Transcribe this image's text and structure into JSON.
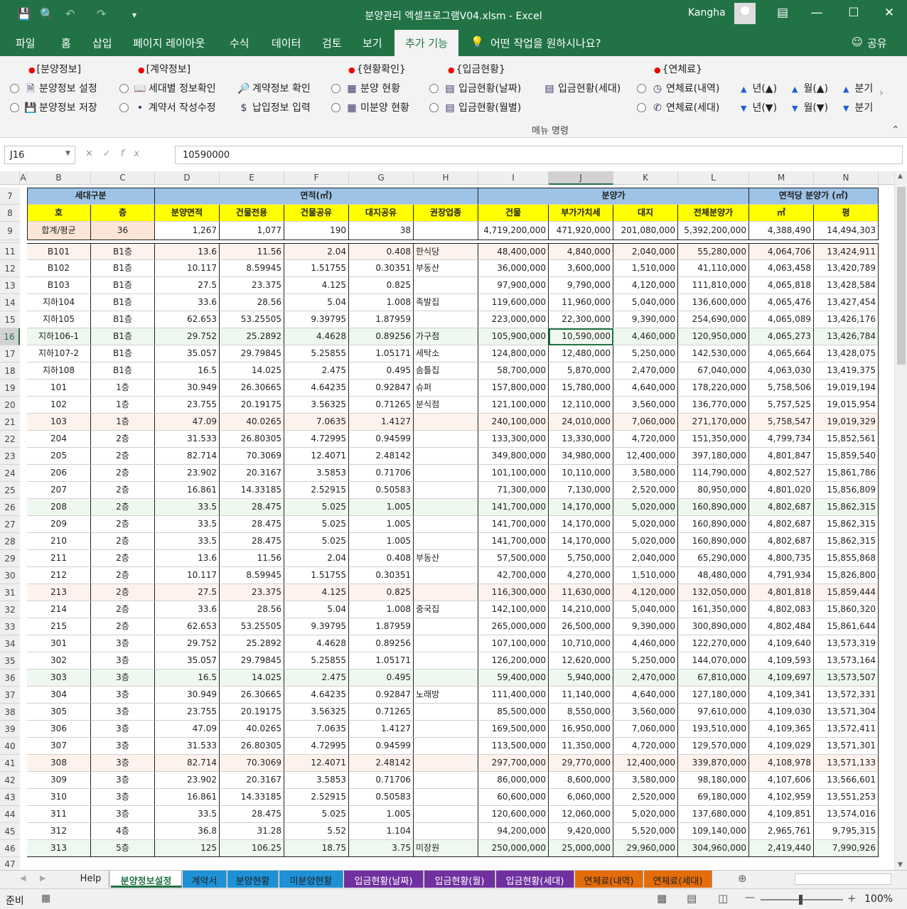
{
  "window": {
    "title": "분양관리 엑셀프로그램V04.xlsm  -  Excel",
    "user": "Kangha"
  },
  "ribbon_tabs": [
    "파일",
    "홈",
    "삽입",
    "페이지 레이아웃",
    "수식",
    "데이터",
    "검토",
    "보기",
    "추가 기능"
  ],
  "tell_me": "어떤 작업을 원하시나요?",
  "share": "공유",
  "ribbon": {
    "groups": [
      {
        "header": "[분양정보]",
        "items": [
          "분양정보 설정",
          "분양정보 저장"
        ]
      },
      {
        "header": "[계약정보]",
        "items": [
          "세대별 정보확인",
          "계약서 작성수정"
        ]
      },
      {
        "extra": [
          "계약정보 확인",
          "납입정보 입력"
        ]
      },
      {
        "header": "{현황확인}",
        "items": [
          "분양 현황",
          "미분양 현황"
        ]
      },
      {
        "header": "{입금현황}",
        "items": [
          "입금현황(날짜)",
          "입금현황(월별)"
        ]
      },
      {
        "extra": [
          "입금현황(세대)"
        ]
      },
      {
        "header": "{연체료}",
        "items": [
          "연체료(내역)",
          "연체료(세대)"
        ]
      }
    ],
    "spin": {
      "up": [
        "년(▲)",
        "월(▲)",
        "분기"
      ],
      "down": [
        "년(▼)",
        "월(▼)",
        "분기"
      ]
    },
    "footer": "메뉴 명령"
  },
  "formula_bar": {
    "name_box": "J16",
    "value": "10590000"
  },
  "columns": [
    "A",
    "B",
    "C",
    "D",
    "E",
    "F",
    "G",
    "H",
    "I",
    "J",
    "K",
    "L",
    "M",
    "N"
  ],
  "header": {
    "group1": [
      "세대구분",
      "면적(㎡)",
      "분양가",
      "면적당 분양가 (㎡)"
    ],
    "group2": [
      "호",
      "층",
      "분양면적",
      "건물전용",
      "건물공유",
      "대지공유",
      "권장업종",
      "건물",
      "부가가치세",
      "대지",
      "전체분양가",
      "㎡",
      "평"
    ],
    "totals": [
      "합계/평균",
      "36",
      "1,267",
      "1,077",
      "190",
      "38",
      "",
      "4,719,200,000",
      "471,920,000",
      "201,080,000",
      "5,392,200,000",
      "4,388,490",
      "14,494,303"
    ]
  },
  "rows": [
    [
      "11",
      "B101",
      "B1층",
      "13.6",
      "11.56",
      "2.04",
      "0.408",
      "한식당",
      "48,400,000",
      "4,840,000",
      "2,040,000",
      "55,280,000",
      "4,064,706",
      "13,424,911"
    ],
    [
      "12",
      "B102",
      "B1층",
      "10.117",
      "8.59945",
      "1.51755",
      "0.30351",
      "부동산",
      "36,000,000",
      "3,600,000",
      "1,510,000",
      "41,110,000",
      "4,063,458",
      "13,420,789"
    ],
    [
      "13",
      "B103",
      "B1층",
      "27.5",
      "23.375",
      "4.125",
      "0.825",
      "",
      "97,900,000",
      "9,790,000",
      "4,120,000",
      "111,810,000",
      "4,065,818",
      "13,428,584"
    ],
    [
      "14",
      "지하104",
      "B1층",
      "33.6",
      "28.56",
      "5.04",
      "1.008",
      "족발집",
      "119,600,000",
      "11,960,000",
      "5,040,000",
      "136,600,000",
      "4,065,476",
      "13,427,454"
    ],
    [
      "15",
      "지하105",
      "B1층",
      "62.653",
      "53.25505",
      "9.39795",
      "1.87959",
      "",
      "223,000,000",
      "22,300,000",
      "9,390,000",
      "254,690,000",
      "4,065,089",
      "13,426,176"
    ],
    [
      "16",
      "지하106-1",
      "B1층",
      "29.752",
      "25.2892",
      "4.4628",
      "0.89256",
      "가구점",
      "105,900,000",
      "10,590,000",
      "4,460,000",
      "120,950,000",
      "4,065,273",
      "13,426,784"
    ],
    [
      "17",
      "지하107-2",
      "B1층",
      "35.057",
      "29.79845",
      "5.25855",
      "1.05171",
      "세탁소",
      "124,800,000",
      "12,480,000",
      "5,250,000",
      "142,530,000",
      "4,065,664",
      "13,428,075"
    ],
    [
      "18",
      "지하108",
      "B1층",
      "16.5",
      "14.025",
      "2.475",
      "0.495",
      "솜틀집",
      "58,700,000",
      "5,870,000",
      "2,470,000",
      "67,040,000",
      "4,063,030",
      "13,419,375"
    ],
    [
      "19",
      "101",
      "1층",
      "30.949",
      "26.30665",
      "4.64235",
      "0.92847",
      "슈퍼",
      "157,800,000",
      "15,780,000",
      "4,640,000",
      "178,220,000",
      "5,758,506",
      "19,019,194"
    ],
    [
      "20",
      "102",
      "1층",
      "23.755",
      "20.19175",
      "3.56325",
      "0.71265",
      "분식점",
      "121,100,000",
      "12,110,000",
      "3,560,000",
      "136,770,000",
      "5,757,525",
      "19,015,954"
    ],
    [
      "21",
      "103",
      "1층",
      "47.09",
      "40.0265",
      "7.0635",
      "1.4127",
      "",
      "240,100,000",
      "24,010,000",
      "7,060,000",
      "271,170,000",
      "5,758,547",
      "19,019,329"
    ],
    [
      "22",
      "204",
      "2층",
      "31.533",
      "26.80305",
      "4.72995",
      "0.94599",
      "",
      "133,300,000",
      "13,330,000",
      "4,720,000",
      "151,350,000",
      "4,799,734",
      "15,852,561"
    ],
    [
      "23",
      "205",
      "2층",
      "82.714",
      "70.3069",
      "12.4071",
      "2.48142",
      "",
      "349,800,000",
      "34,980,000",
      "12,400,000",
      "397,180,000",
      "4,801,847",
      "15,859,540"
    ],
    [
      "24",
      "206",
      "2층",
      "23.902",
      "20.3167",
      "3.5853",
      "0.71706",
      "",
      "101,100,000",
      "10,110,000",
      "3,580,000",
      "114,790,000",
      "4,802,527",
      "15,861,786"
    ],
    [
      "25",
      "207",
      "2층",
      "16.861",
      "14.33185",
      "2.52915",
      "0.50583",
      "",
      "71,300,000",
      "7,130,000",
      "2,520,000",
      "80,950,000",
      "4,801,020",
      "15,856,809"
    ],
    [
      "26",
      "208",
      "2층",
      "33.5",
      "28.475",
      "5.025",
      "1.005",
      "",
      "141,700,000",
      "14,170,000",
      "5,020,000",
      "160,890,000",
      "4,802,687",
      "15,862,315"
    ],
    [
      "27",
      "209",
      "2층",
      "33.5",
      "28.475",
      "5.025",
      "1.005",
      "",
      "141,700,000",
      "14,170,000",
      "5,020,000",
      "160,890,000",
      "4,802,687",
      "15,862,315"
    ],
    [
      "28",
      "210",
      "2층",
      "33.5",
      "28.475",
      "5.025",
      "1.005",
      "",
      "141,700,000",
      "14,170,000",
      "5,020,000",
      "160,890,000",
      "4,802,687",
      "15,862,315"
    ],
    [
      "29",
      "211",
      "2층",
      "13.6",
      "11.56",
      "2.04",
      "0.408",
      "부동산",
      "57,500,000",
      "5,750,000",
      "2,040,000",
      "65,290,000",
      "4,800,735",
      "15,855,868"
    ],
    [
      "30",
      "212",
      "2층",
      "10.117",
      "8.59945",
      "1.51755",
      "0.30351",
      "",
      "42,700,000",
      "4,270,000",
      "1,510,000",
      "48,480,000",
      "4,791,934",
      "15,826,800"
    ],
    [
      "31",
      "213",
      "2층",
      "27.5",
      "23.375",
      "4.125",
      "0.825",
      "",
      "116,300,000",
      "11,630,000",
      "4,120,000",
      "132,050,000",
      "4,801,818",
      "15,859,444"
    ],
    [
      "32",
      "214",
      "2층",
      "33.6",
      "28.56",
      "5.04",
      "1.008",
      "중국집",
      "142,100,000",
      "14,210,000",
      "5,040,000",
      "161,350,000",
      "4,802,083",
      "15,860,320"
    ],
    [
      "33",
      "215",
      "2층",
      "62.653",
      "53.25505",
      "9.39795",
      "1.87959",
      "",
      "265,000,000",
      "26,500,000",
      "9,390,000",
      "300,890,000",
      "4,802,484",
      "15,861,644"
    ],
    [
      "34",
      "301",
      "3층",
      "29.752",
      "25.2892",
      "4.4628",
      "0.89256",
      "",
      "107,100,000",
      "10,710,000",
      "4,460,000",
      "122,270,000",
      "4,109,640",
      "13,573,319"
    ],
    [
      "35",
      "302",
      "3층",
      "35.057",
      "29.79845",
      "5.25855",
      "1.05171",
      "",
      "126,200,000",
      "12,620,000",
      "5,250,000",
      "144,070,000",
      "4,109,593",
      "13,573,164"
    ],
    [
      "36",
      "303",
      "3층",
      "16.5",
      "14.025",
      "2.475",
      "0.495",
      "",
      "59,400,000",
      "5,940,000",
      "2,470,000",
      "67,810,000",
      "4,109,697",
      "13,573,507"
    ],
    [
      "37",
      "304",
      "3층",
      "30.949",
      "26.30665",
      "4.64235",
      "0.92847",
      "노래방",
      "111,400,000",
      "11,140,000",
      "4,640,000",
      "127,180,000",
      "4,109,341",
      "13,572,331"
    ],
    [
      "38",
      "305",
      "3층",
      "23.755",
      "20.19175",
      "3.56325",
      "0.71265",
      "",
      "85,500,000",
      "8,550,000",
      "3,560,000",
      "97,610,000",
      "4,109,030",
      "13,571,304"
    ],
    [
      "39",
      "306",
      "3층",
      "47.09",
      "40.0265",
      "7.0635",
      "1.4127",
      "",
      "169,500,000",
      "16,950,000",
      "7,060,000",
      "193,510,000",
      "4,109,365",
      "13,572,411"
    ],
    [
      "40",
      "307",
      "3층",
      "31.533",
      "26.80305",
      "4.72995",
      "0.94599",
      "",
      "113,500,000",
      "11,350,000",
      "4,720,000",
      "129,570,000",
      "4,109,029",
      "13,571,301"
    ],
    [
      "41",
      "308",
      "3층",
      "82.714",
      "70.3069",
      "12.4071",
      "2.48142",
      "",
      "297,700,000",
      "29,770,000",
      "12,400,000",
      "339,870,000",
      "4,108,978",
      "13,571,133"
    ],
    [
      "42",
      "309",
      "3층",
      "23.902",
      "20.3167",
      "3.5853",
      "0.71706",
      "",
      "86,000,000",
      "8,600,000",
      "3,580,000",
      "98,180,000",
      "4,107,606",
      "13,566,601"
    ],
    [
      "43",
      "310",
      "3층",
      "16.861",
      "14.33185",
      "2.52915",
      "0.50583",
      "",
      "60,600,000",
      "6,060,000",
      "2,520,000",
      "69,180,000",
      "4,102,959",
      "13,551,253"
    ],
    [
      "44",
      "311",
      "3층",
      "33.5",
      "28.475",
      "5.025",
      "1.005",
      "",
      "120,600,000",
      "12,060,000",
      "5,020,000",
      "137,680,000",
      "4,109,851",
      "13,574,016"
    ],
    [
      "45",
      "312",
      "4층",
      "36.8",
      "31.28",
      "5.52",
      "1.104",
      "",
      "94,200,000",
      "9,420,000",
      "5,520,000",
      "109,140,000",
      "2,965,761",
      "9,795,315"
    ],
    [
      "46",
      "313",
      "5층",
      "125",
      "106.25",
      "18.75",
      "3.75",
      "미장원",
      "250,000,000",
      "25,000,000",
      "29,960,000",
      "304,960,000",
      "2,419,440",
      "7,990,926"
    ]
  ],
  "sheet_tabs": [
    {
      "label": "Help",
      "color": "#f0f0f0"
    },
    {
      "label": "분양정보설정",
      "color": "#ffffff"
    },
    {
      "label": "계약서",
      "color": "#1e90d6"
    },
    {
      "label": "분양현황",
      "color": "#1e90d6"
    },
    {
      "label": "미분양현황",
      "color": "#1e90d6"
    },
    {
      "label": "입금현황(날짜)",
      "color": "#7030a0"
    },
    {
      "label": "입금현황(월)",
      "color": "#7030a0"
    },
    {
      "label": "입금현황(세대)",
      "color": "#7030a0"
    },
    {
      "label": "연체료(내역)",
      "color": "#e46c0a"
    },
    {
      "label": "연체료(세대)",
      "color": "#e46c0a"
    }
  ],
  "status": {
    "ready": "준비",
    "zoom": "100%"
  },
  "colors": {
    "accent": "#217346",
    "header_blue": "#9dc3e6",
    "header_yellow": "#ffff00",
    "totals_orange": "#fbe5d6",
    "selected": "#217346"
  }
}
